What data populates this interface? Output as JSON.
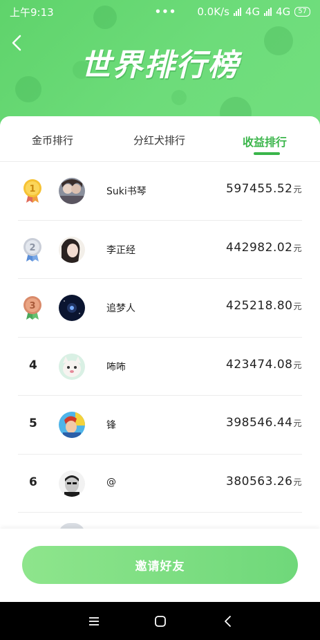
{
  "status_bar": {
    "time": "上午9:13",
    "dots": "•••",
    "speed": "0.0K/s",
    "network1": "4G",
    "network2": "4G",
    "battery": "57"
  },
  "header": {
    "title": "世界排行榜",
    "back_icon": "chevron-left-icon"
  },
  "tabs": [
    {
      "label": "金币排行",
      "active": false
    },
    {
      "label": "分红犬排行",
      "active": false
    },
    {
      "label": "收益排行",
      "active": true
    }
  ],
  "rankings": [
    {
      "rank": "1",
      "badge": "gold-medal-icon",
      "name": "Suki书琴",
      "amount": "597455.52",
      "unit": "元"
    },
    {
      "rank": "2",
      "badge": "silver-medal-icon",
      "name": "李正经",
      "amount": "442982.02",
      "unit": "元"
    },
    {
      "rank": "3",
      "badge": "bronze-medal-icon",
      "name": "追梦人",
      "amount": "425218.80",
      "unit": "元"
    },
    {
      "rank": "4",
      "name": "咘咘",
      "amount": "423474.08",
      "unit": "元"
    },
    {
      "rank": "5",
      "name": "锋",
      "amount": "398546.44",
      "unit": "元"
    },
    {
      "rank": "6",
      "name": "@",
      "amount": "380563.26",
      "unit": "元"
    }
  ],
  "footer": {
    "invite_label": "邀请好友"
  },
  "colors": {
    "header_green": "#5fd36b",
    "accent_green": "#3ab54a",
    "button_green": "#7fdf84"
  }
}
